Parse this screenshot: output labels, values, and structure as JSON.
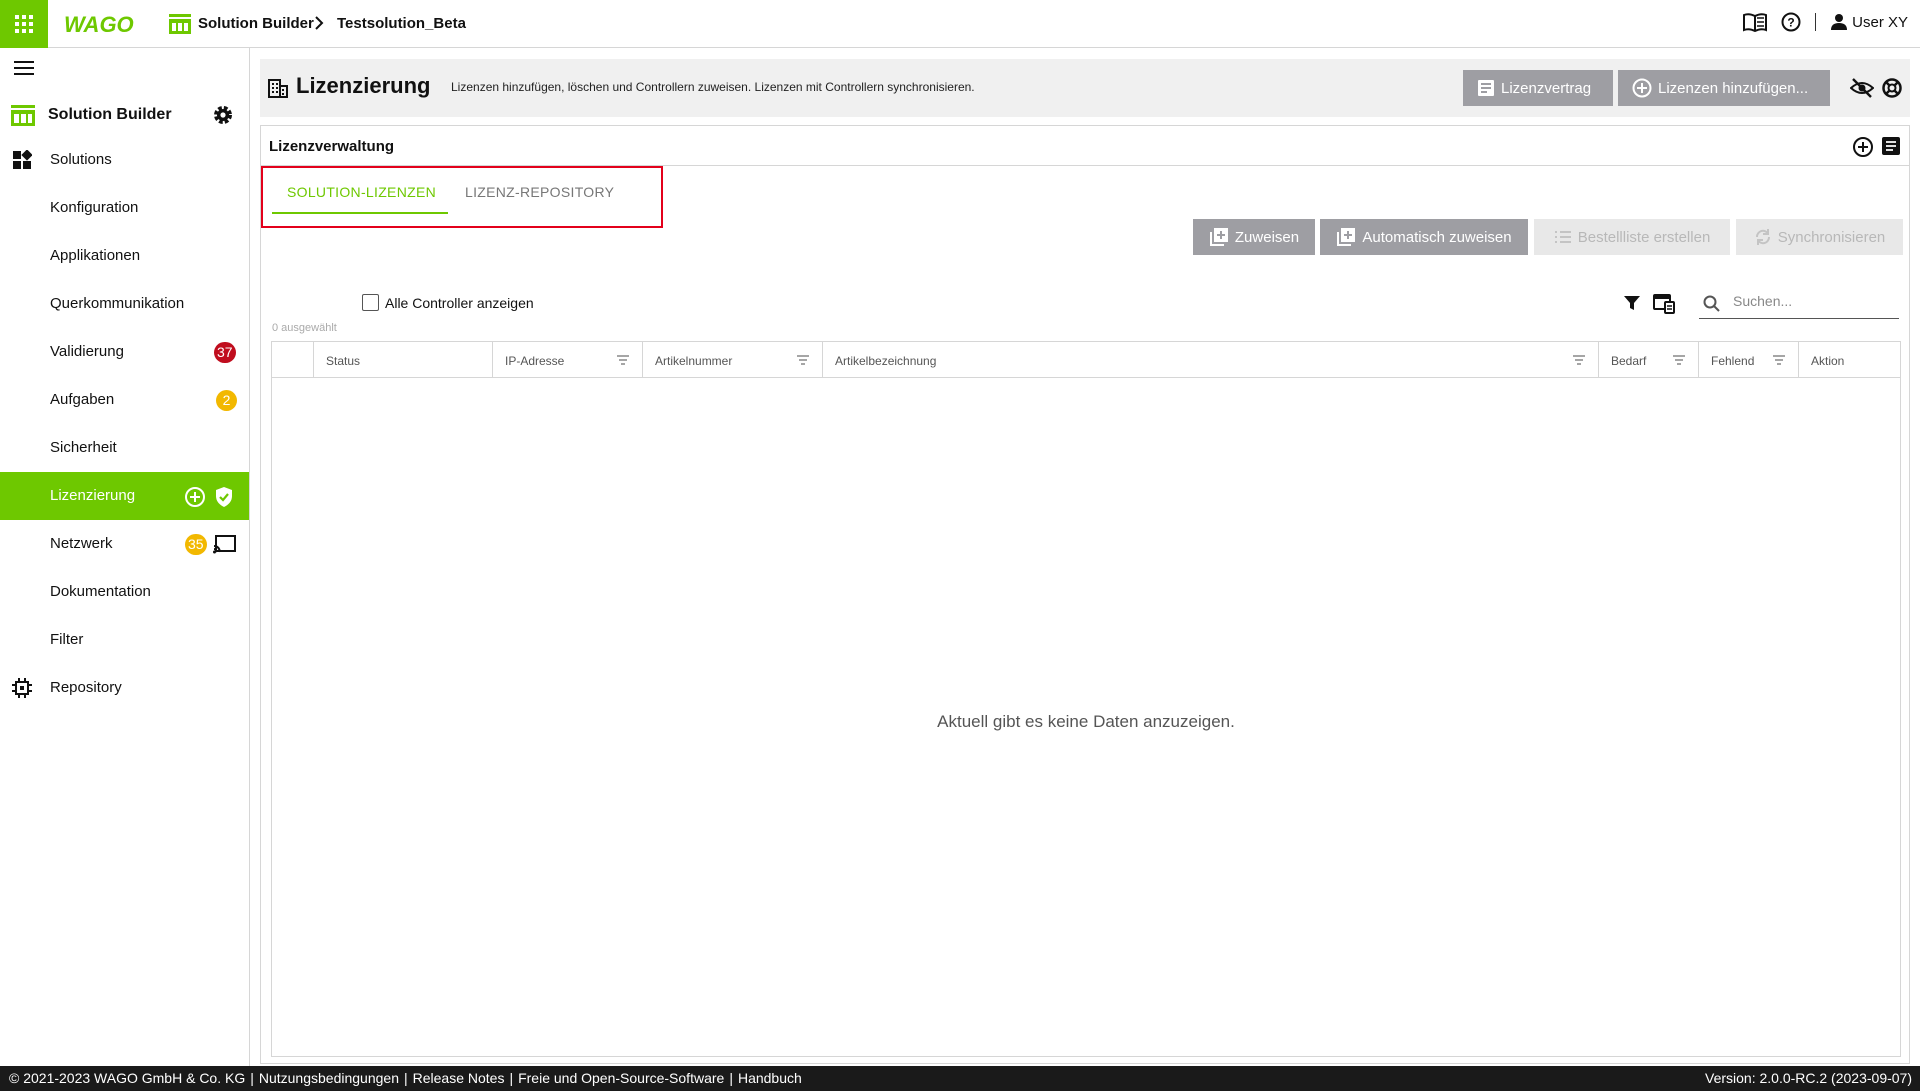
{
  "header": {
    "logo_text": "WAGO",
    "breadcrumb": [
      "Solution Builder",
      "Testsolution_Beta"
    ],
    "user_label": "User XY"
  },
  "sidebar": {
    "title": "Solution Builder",
    "items": [
      {
        "label": "Solutions",
        "icon": "dashboard-icon"
      },
      {
        "label": "Konfiguration"
      },
      {
        "label": "Applikationen"
      },
      {
        "label": "Querkommunikation"
      },
      {
        "label": "Validierung",
        "badge": "37",
        "badge_color": "#c00d1e"
      },
      {
        "label": "Aufgaben",
        "badge": "2",
        "badge_color": "#f2b800"
      },
      {
        "label": "Sicherheit"
      },
      {
        "label": "Lizenzierung",
        "active": true,
        "icons": [
          "plus-circle-icon",
          "shield-check-icon"
        ]
      },
      {
        "label": "Netzwerk",
        "badge": "35",
        "badge_color": "#f2b800",
        "icon_right": "cast-icon"
      },
      {
        "label": "Dokumentation"
      },
      {
        "label": "Filter"
      },
      {
        "label": "Repository",
        "icon": "chip-icon"
      }
    ]
  },
  "page": {
    "title": "Lizenzierung",
    "description": "Lizenzen hinzufügen, löschen und Controllern zuweisen. Lizenzen mit Controllern synchronisieren.",
    "btn_contract": "Lizenzvertrag",
    "btn_add_licenses": "Lizenzen hinzufügen..."
  },
  "panel": {
    "title": "Lizenzverwaltung",
    "tabs": [
      {
        "label": "SOLUTION-LIZENZEN",
        "active": true
      },
      {
        "label": "LIZENZ-REPOSITORY",
        "active": false
      }
    ],
    "actions": [
      {
        "label": "Zuweisen",
        "enabled": true
      },
      {
        "label": "Automatisch zuweisen",
        "enabled": true
      },
      {
        "label": "Bestellliste erstellen",
        "enabled": false
      },
      {
        "label": "Synchronisieren",
        "enabled": false
      }
    ],
    "show_all_label": "Alle Controller anzeigen",
    "show_all_checked": false,
    "selected_count": "0 ausgewählt",
    "search_placeholder": "Suchen...",
    "columns": [
      "Status",
      "IP-Adresse",
      "Artikelnummer",
      "Artikelbezeichnung",
      "Bedarf",
      "Fehlend",
      "Aktion"
    ],
    "empty_message": "Aktuell gibt es keine Daten anzuzeigen."
  },
  "footer": {
    "copyright": "© 2021-2023 WAGO GmbH & Co. KG",
    "links": [
      "Nutzungsbedingungen",
      "Release Notes",
      "Freie und Open-Source-Software",
      "Handbuch"
    ],
    "version": "Version: 2.0.0-RC.2 (2023-09-07)"
  },
  "colors": {
    "accent_green": "#6ec800",
    "badge_red": "#c00d1e",
    "badge_yellow": "#f2b800",
    "button_grey": "#9e9ea3",
    "highlight_red": "#e3001b"
  }
}
